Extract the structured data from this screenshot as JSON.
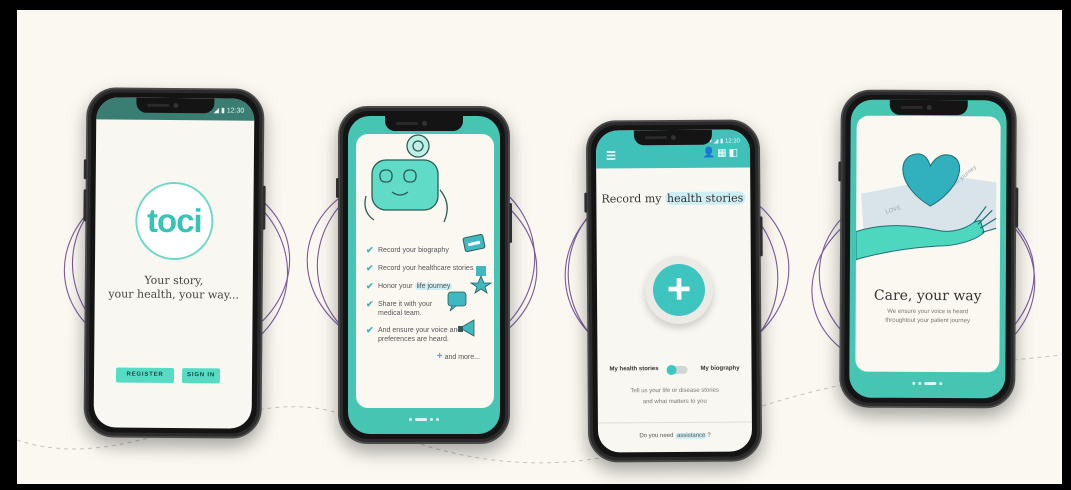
{
  "phone1": {
    "status_time": "▾ ◢ ▮ 12:30",
    "logo": "toci",
    "tagline_line1": "Your story,",
    "tagline_line2": "your health, your way...",
    "register_label": "REGISTER",
    "signin_label": "SIGN IN"
  },
  "phone2": {
    "items": [
      {
        "text": "Record your biography"
      },
      {
        "text": "Record your healthcare stories"
      },
      {
        "text_before": "Honor your ",
        "highlight": "life journey"
      },
      {
        "line1": "Share it with your",
        "line2": "medical team."
      },
      {
        "line1": "And ensure your voice and",
        "line2": "preferences are heard."
      }
    ],
    "more_plus": "+",
    "more_label": "and more..."
  },
  "phone3": {
    "status_time": "▾ ◢ ▮ 12:30",
    "menu_icon": "menu-icon",
    "title_before": "Record my ",
    "title_highlight": "health stories",
    "fab_symbol": "+",
    "toggle_left": "My health stories",
    "toggle_right": "My biography",
    "desc_line1": "Tell us your life or disease stories",
    "desc_line2": "and what matters to you",
    "footer_before": "Do you need ",
    "footer_highlight": "assistance",
    "footer_after": "?"
  },
  "phone4": {
    "title": "Care, your way",
    "sub_line1": "We ensure your voice is heard",
    "sub_line2": "throughtout your patient journey",
    "card_word_1": "LOVE",
    "card_word_2": "life journey"
  },
  "colors": {
    "teal": "#3fc5c0",
    "mint": "#57dcc4",
    "dark_teal": "#3a7e73",
    "background": "#fbf8f1",
    "purple_ring": "#7a5a9a"
  }
}
